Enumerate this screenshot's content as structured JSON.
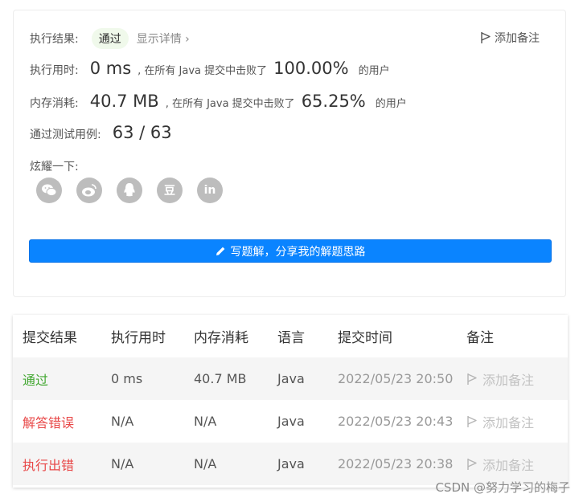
{
  "result": {
    "label": "执行结果:",
    "status": "通过",
    "details": "显示详情 ›",
    "add_note": "添加备注"
  },
  "runtime": {
    "label": "执行用时:",
    "value": "0 ms",
    "prefix": ", 在所有 Java 提交中击败了",
    "percent": "100.00%",
    "suffix": "的用户"
  },
  "memory": {
    "label": "内存消耗:",
    "value": "40.7 MB",
    "prefix": ", 在所有 Java 提交中击败了",
    "percent": "65.25%",
    "suffix": "的用户"
  },
  "tests": {
    "label": "通过测试用例:",
    "value": "63 / 63"
  },
  "share": {
    "label": "炫耀一下:",
    "icons": [
      "wechat-icon",
      "weibo-icon",
      "qq-icon",
      "douban-icon",
      "linkedin-icon"
    ],
    "douban_glyph": "豆",
    "linkedin_glyph": "in"
  },
  "write_button": "写题解，分享我的解题思路",
  "table": {
    "headers": [
      "提交结果",
      "执行用时",
      "内存消耗",
      "语言",
      "提交时间",
      "备注"
    ],
    "rows": [
      {
        "result": "通过",
        "runtime": "0 ms",
        "memory": "40.7 MB",
        "lang": "Java",
        "time": "2022/05/23 20:50",
        "note": "添加备注"
      },
      {
        "result": "解答错误",
        "runtime": "N/A",
        "memory": "N/A",
        "lang": "Java",
        "time": "2022/05/23 20:43",
        "note": "添加备注"
      },
      {
        "result": "执行出错",
        "runtime": "N/A",
        "memory": "N/A",
        "lang": "Java",
        "time": "2022/05/23 20:38",
        "note": "添加备注"
      }
    ]
  },
  "watermark": "CSDN @努力学习的梅子",
  "colors": {
    "accent": "#0a84ff",
    "pass": "#43a832",
    "error": "#e84848",
    "badge_bg": "#f0f9eb"
  }
}
